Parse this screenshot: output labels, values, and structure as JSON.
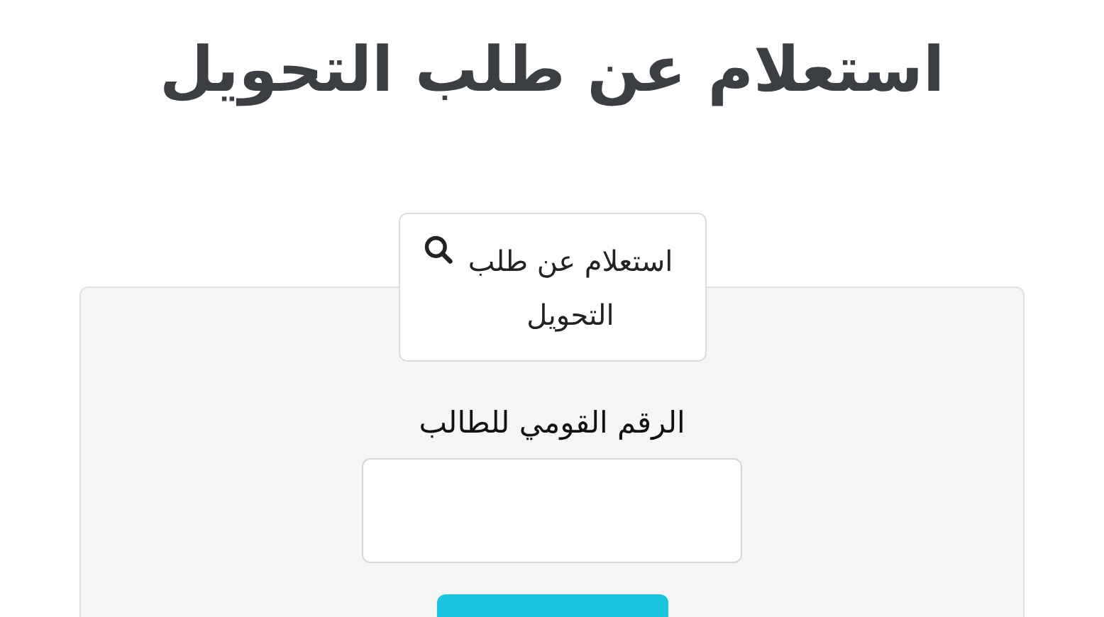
{
  "page_title": "استعلام عن طلب التحويل",
  "tab": {
    "label": "استعلام عن طلب التحويل",
    "selected": true
  },
  "form": {
    "field_label": "الرقم القومي للطالب"
  }
}
